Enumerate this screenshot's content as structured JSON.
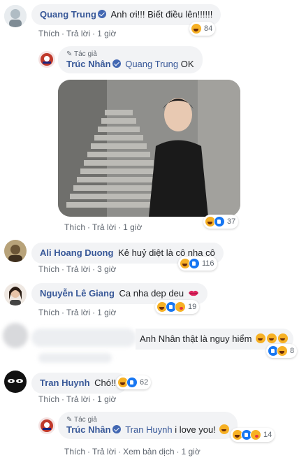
{
  "comments": [
    {
      "author": "Quang Trung",
      "verified": true,
      "text": "Anh ơi!!! Biết điều lên!!!!!!",
      "actions": {
        "like": "Thích",
        "reply": "Trả lời",
        "time": "1 giờ"
      },
      "reactions": {
        "icons": [
          "haha-icon"
        ],
        "count": "84"
      },
      "reply": {
        "badge": "Tác giả",
        "author": "Trúc Nhân",
        "verified": true,
        "mention": "Quang Trung",
        "text": "OK",
        "actions": {
          "like": "Thích",
          "reply": "Trả lời",
          "time": "1 giờ"
        },
        "reactions": {
          "icons": [
            "haha-icon",
            "like-icon"
          ],
          "count": "37"
        }
      }
    },
    {
      "author": "Ali Hoang Duong",
      "text": "Kẻ huỷ diệt là cô nha cô",
      "actions": {
        "like": "Thích",
        "reply": "Trả lời",
        "time": "3 giờ"
      },
      "reactions": {
        "icons": [
          "haha-icon",
          "like-icon"
        ],
        "count": "116"
      }
    },
    {
      "author": "Nguyễn Lê Giang",
      "text": "Ca nha dep deu",
      "actions": {
        "like": "Thích",
        "reply": "Trả lời",
        "time": "1 giờ"
      },
      "reactions": {
        "icons": [
          "haha-icon",
          "like-icon",
          "hug-icon"
        ],
        "count": "19"
      }
    },
    {
      "author": "",
      "text": "Anh Nhân thật là nguy hiểm",
      "actions": {
        "like": "Thích",
        "reply": "Trả lời",
        "time": "1 giờ"
      },
      "reactions": {
        "icons": [
          "like-icon",
          "haha-icon"
        ],
        "count": "8"
      }
    },
    {
      "author": "Tran Huynh",
      "text": "Chó!!!",
      "actions": {
        "like": "Thích",
        "reply": "Trả lời",
        "time": "1 giờ"
      },
      "reactions": {
        "icons": [
          "haha-icon",
          "like-icon"
        ],
        "count": "62"
      },
      "reply": {
        "badge": "Tác giả",
        "author": "Trúc Nhân",
        "verified": true,
        "mention": "Tran Huynh",
        "text": "i love you!",
        "actions": {
          "like": "Thích",
          "reply": "Trả lời",
          "translate": "Xem bản dịch",
          "time": "1 giờ"
        },
        "reactions": {
          "icons": [
            "haha-icon",
            "like-icon",
            "hug-icon"
          ],
          "count": "14"
        }
      }
    }
  ],
  "colors": {
    "link": "#385898",
    "bubble": "#f2f3f5",
    "meta": "#606770",
    "like": "#1877f2",
    "haha": "#f7b125"
  }
}
